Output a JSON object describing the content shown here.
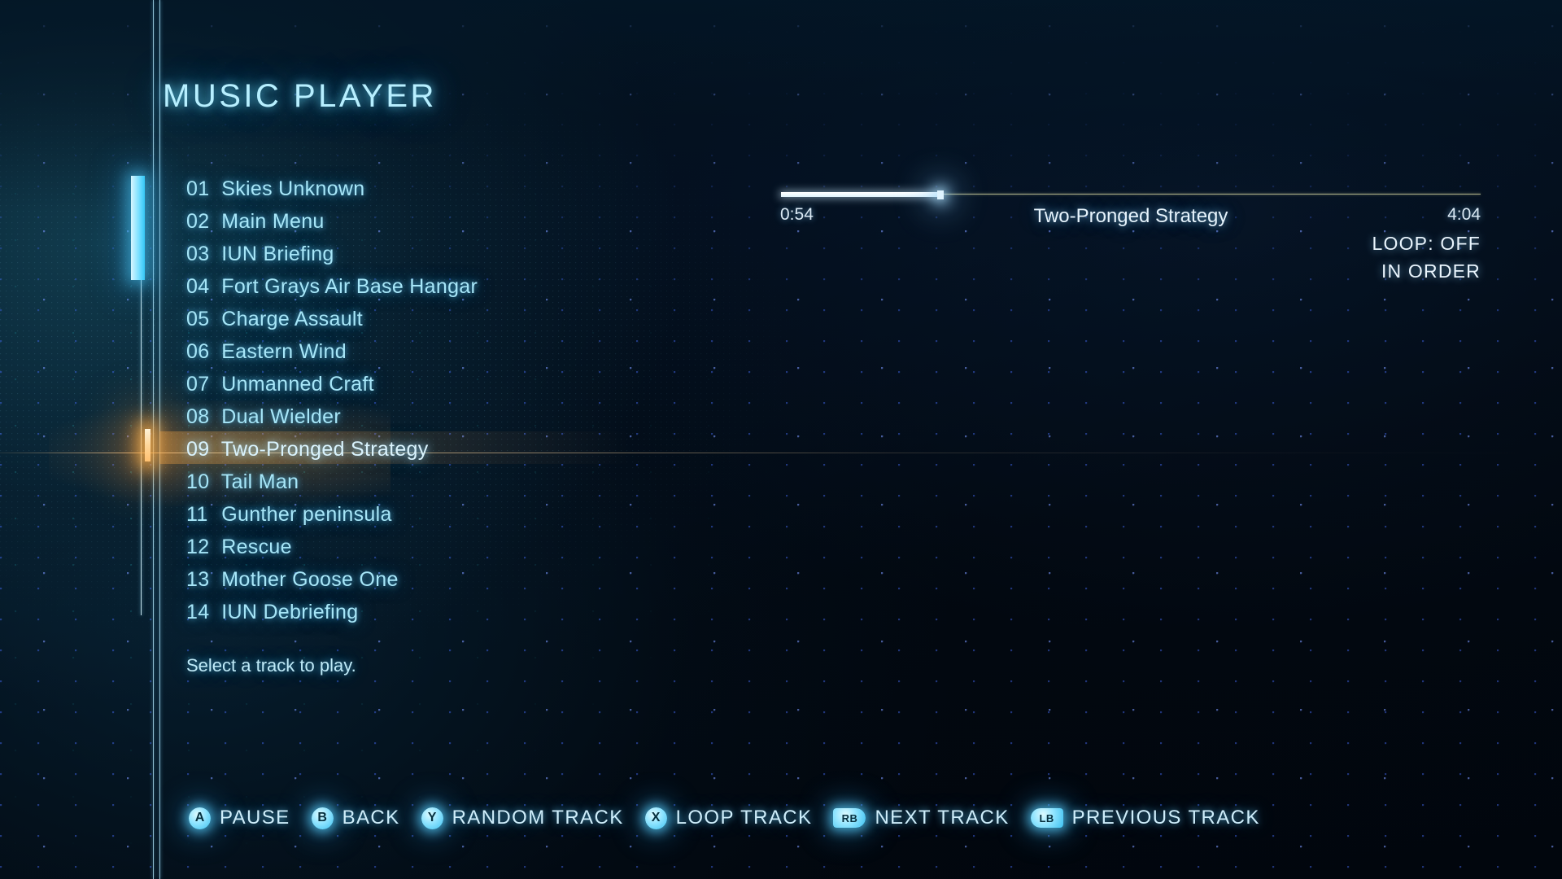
{
  "header": {
    "title": "MUSIC PLAYER"
  },
  "tracklist": {
    "selected_index": 8,
    "hint": "Select a track to play.",
    "items": [
      {
        "num": "01",
        "name": "Skies Unknown"
      },
      {
        "num": "02",
        "name": "Main Menu"
      },
      {
        "num": "03",
        "name": "IUN Briefing"
      },
      {
        "num": "04",
        "name": "Fort Grays Air Base Hangar"
      },
      {
        "num": "05",
        "name": "Charge Assault"
      },
      {
        "num": "06",
        "name": "Eastern Wind"
      },
      {
        "num": "07",
        "name": "Unmanned Craft"
      },
      {
        "num": "08",
        "name": "Dual Wielder"
      },
      {
        "num": "09",
        "name": "Two-Pronged Strategy"
      },
      {
        "num": "10",
        "name": "Tail Man"
      },
      {
        "num": "11",
        "name": "Gunther peninsula"
      },
      {
        "num": "12",
        "name": "Rescue"
      },
      {
        "num": "13",
        "name": "Mother Goose One"
      },
      {
        "num": "14",
        "name": "IUN Debriefing"
      }
    ]
  },
  "now_playing": {
    "title": "Two-Pronged Strategy",
    "elapsed": "0:54",
    "total": "4:04",
    "progress_percent": 23,
    "loop": "LOOP: OFF",
    "order": "IN ORDER"
  },
  "legend": {
    "items": [
      {
        "glyph": "A",
        "type": "face",
        "label": "PAUSE"
      },
      {
        "glyph": "B",
        "type": "face",
        "label": "BACK"
      },
      {
        "glyph": "Y",
        "type": "face",
        "label": "RANDOM TRACK"
      },
      {
        "glyph": "X",
        "type": "face",
        "label": "LOOP TRACK"
      },
      {
        "glyph": "RB",
        "type": "bumper",
        "label": "NEXT TRACK"
      },
      {
        "glyph": "LB",
        "type": "bumper",
        "label": "PREVIOUS TRACK"
      }
    ]
  },
  "colors": {
    "accent_cyan": "#a7e6f8",
    "title_cyan": "#b7efff",
    "selection_amber": "#ffb04a",
    "progress_fill": "#ffffff",
    "progress_track": "#e2e2a8",
    "background": "#02080f"
  }
}
